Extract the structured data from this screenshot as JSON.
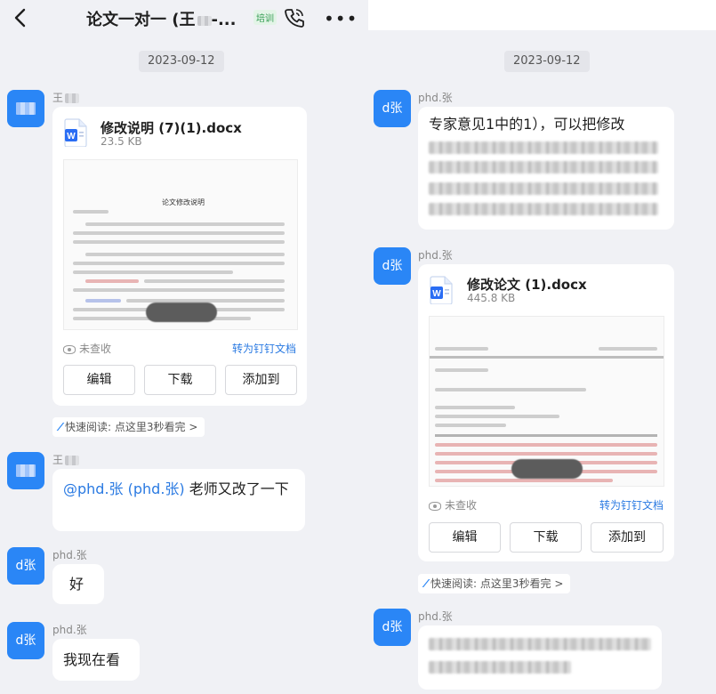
{
  "header": {
    "title": "论文一对一 (王",
    "title_suffix": "-...",
    "tag": "培训",
    "more": "•••"
  },
  "left": {
    "date": "2023-09-12",
    "msg1": {
      "sender": "王",
      "file_name": "修改说明 (7)(1).docx",
      "file_size": "23.5 KB",
      "preview_title": "论文修改说明",
      "status": "未查收",
      "convert": "转为钉钉文档",
      "buttons": [
        "编辑",
        "下载",
        "添加到"
      ]
    },
    "quick_read": "快速阅读: 点这里3秒看完 >",
    "msg2": {
      "sender": "王",
      "mention": "@phd.张 (phd.张)",
      "text": " 老师又改了一下"
    },
    "msg3": {
      "avatar": "d张",
      "sender": "phd.张",
      "text": "好"
    },
    "msg4": {
      "avatar": "d张",
      "sender": "phd.张",
      "text": "我现在看"
    }
  },
  "right": {
    "date": "2023-09-12",
    "msg1": {
      "avatar": "d张",
      "sender": "phd.张",
      "text_first_line": "专家意见1中的1），可以把修改"
    },
    "msg2": {
      "avatar": "d张",
      "sender": "phd.张",
      "file_name": "修改论文 (1).docx",
      "file_size": "445.8 KB",
      "status": "未查收",
      "convert": "转为钉钉文档",
      "buttons": [
        "编辑",
        "下载",
        "添加到"
      ]
    },
    "quick_read": "快速阅读: 点这里3秒看完 >",
    "msg3": {
      "avatar": "d张",
      "sender": "phd.张"
    }
  }
}
